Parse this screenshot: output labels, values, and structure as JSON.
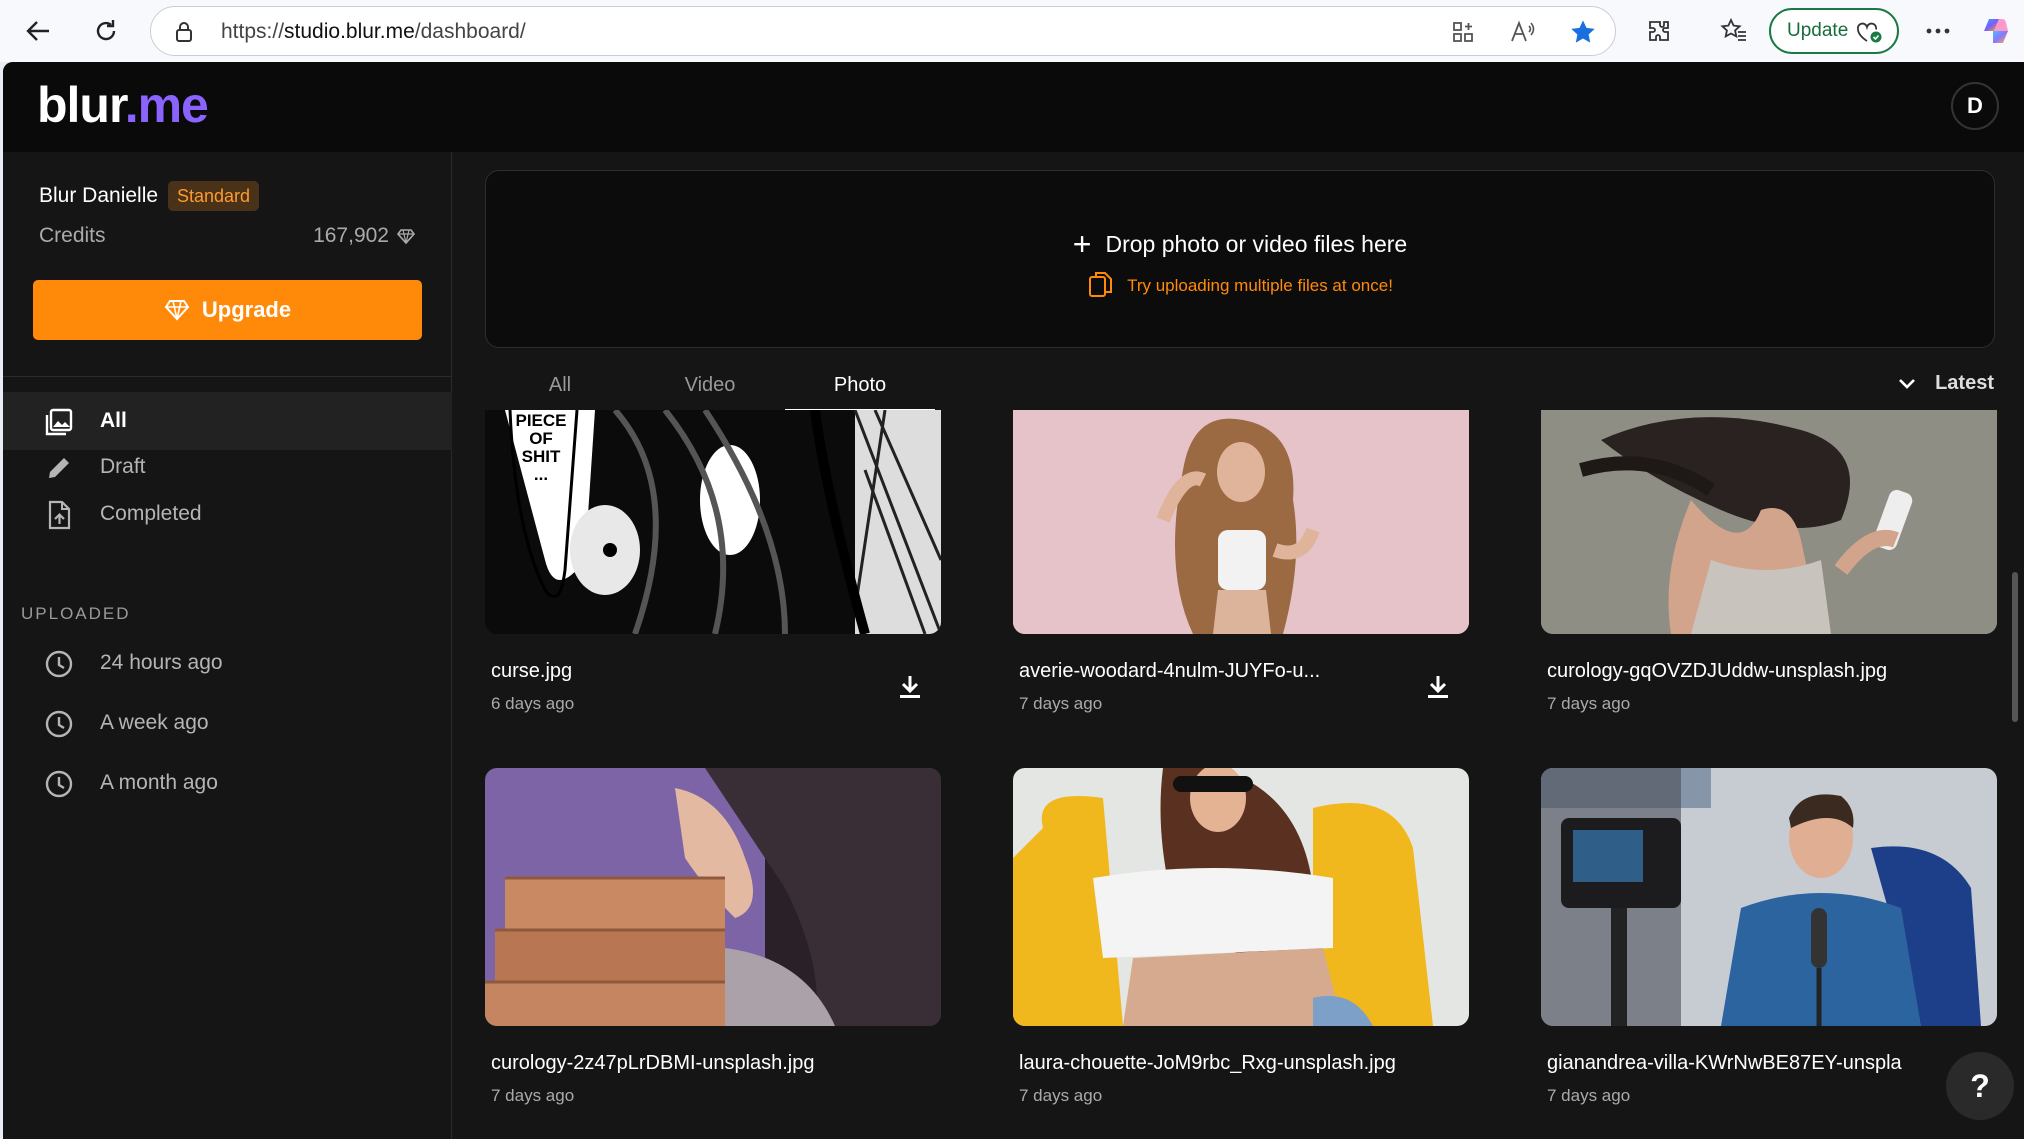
{
  "browser": {
    "url_prefix": "https://",
    "url_host": "studio.blur.me",
    "url_path": "/dashboard/",
    "update_label": "Update"
  },
  "app": {
    "logo_main": "blur",
    "logo_accent": ".me",
    "avatar_initial": "D",
    "accent_color": "#ff8a0a",
    "brand_color": "#8b63ff"
  },
  "sidebar": {
    "user_name": "Blur Danielle",
    "plan": "Standard",
    "credits_label": "Credits",
    "credits_value": "167,902",
    "upgrade_label": "Upgrade",
    "nav": [
      {
        "label": "All",
        "icon": "gallery-icon"
      },
      {
        "label": "Draft",
        "icon": "pencil-icon"
      },
      {
        "label": "Completed",
        "icon": "file-upload-icon"
      }
    ],
    "uploaded_title": "UPLOADED",
    "uploaded": [
      {
        "label": "24 hours ago"
      },
      {
        "label": "A week ago"
      },
      {
        "label": "A month ago"
      }
    ]
  },
  "dropzone": {
    "title": "Drop photo or video files here",
    "hint": "Try uploading multiple files at once!"
  },
  "tabs": [
    {
      "label": "All"
    },
    {
      "label": "Video"
    },
    {
      "label": "Photo"
    }
  ],
  "sort_label": "Latest",
  "files": [
    {
      "name": "curse.jpg",
      "date": "6 days ago"
    },
    {
      "name": "averie-woodard-4nulm-JUYFo-u...",
      "date": "7 days ago"
    },
    {
      "name": "curology-gqOVZDJUddw-unsplash.jpg",
      "date": "7 days ago"
    },
    {
      "name": "curology-2z47pLrDBMI-unsplash.jpg",
      "date": "7 days ago"
    },
    {
      "name": "laura-chouette-JoM9rbc_Rxg-unsplash.jpg",
      "date": "7 days ago"
    },
    {
      "name": "gianandrea-villa-KWrNwBE87EY-unspla",
      "date": "7 days ago"
    }
  ],
  "thumb_text": "PIECE OF SHIT ...",
  "help_label": "?"
}
